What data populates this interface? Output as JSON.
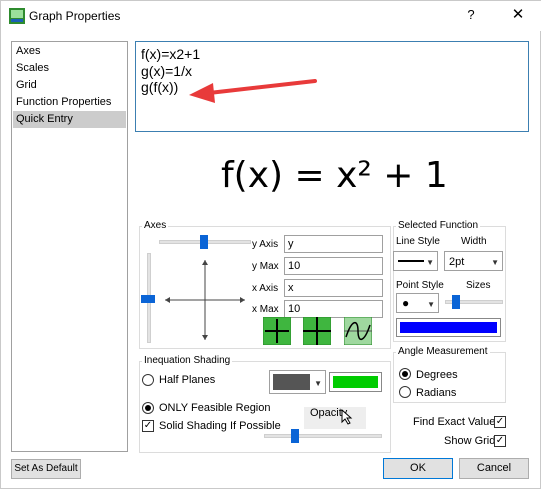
{
  "window": {
    "title": "Graph Properties",
    "help": "?",
    "close": "✕"
  },
  "nav": {
    "items": [
      {
        "label": "Axes"
      },
      {
        "label": "Scales"
      },
      {
        "label": "Grid"
      },
      {
        "label": "Function Properties"
      },
      {
        "label": "Quick Entry",
        "selected": true
      }
    ]
  },
  "quick_entry": {
    "lines": [
      "f(x)=x2+1",
      "g(x)=1/x",
      "g(f(x))"
    ]
  },
  "preview": {
    "formula": "f(x) = x² + 1"
  },
  "axes": {
    "label": "Axes",
    "y_axis_label": "y Axis",
    "y_axis_value": "y",
    "y_max_label": "y Max",
    "y_max_value": "10",
    "x_axis_label": "x Axis",
    "x_axis_value": "x",
    "x_max_label": "x Max",
    "x_max_value": "10"
  },
  "selected_function": {
    "label": "Selected Function",
    "line_style_label": "Line Style",
    "width_label": "Width",
    "width_value": "2pt",
    "point_style_label": "Point Style",
    "sizes_label": "Sizes",
    "color": "#0000ff"
  },
  "inequation": {
    "label": "Inequation Shading",
    "half_planes": "Half Planes",
    "only_feasible": "ONLY Feasible Region",
    "solid_shading": "Solid Shading If Possible",
    "opacity_label": "Opacity",
    "color_dark": "#555555",
    "color_green": "#00cc00"
  },
  "angle": {
    "label": "Angle Measurement",
    "degrees": "Degrees",
    "radians": "Radians"
  },
  "options": {
    "find_exact_values": "Find Exact Values",
    "show_grid": "Show Grid"
  },
  "buttons": {
    "set_default": "Set As Default",
    "ok": "OK",
    "cancel": "Cancel"
  },
  "accent": "#0a64d6"
}
